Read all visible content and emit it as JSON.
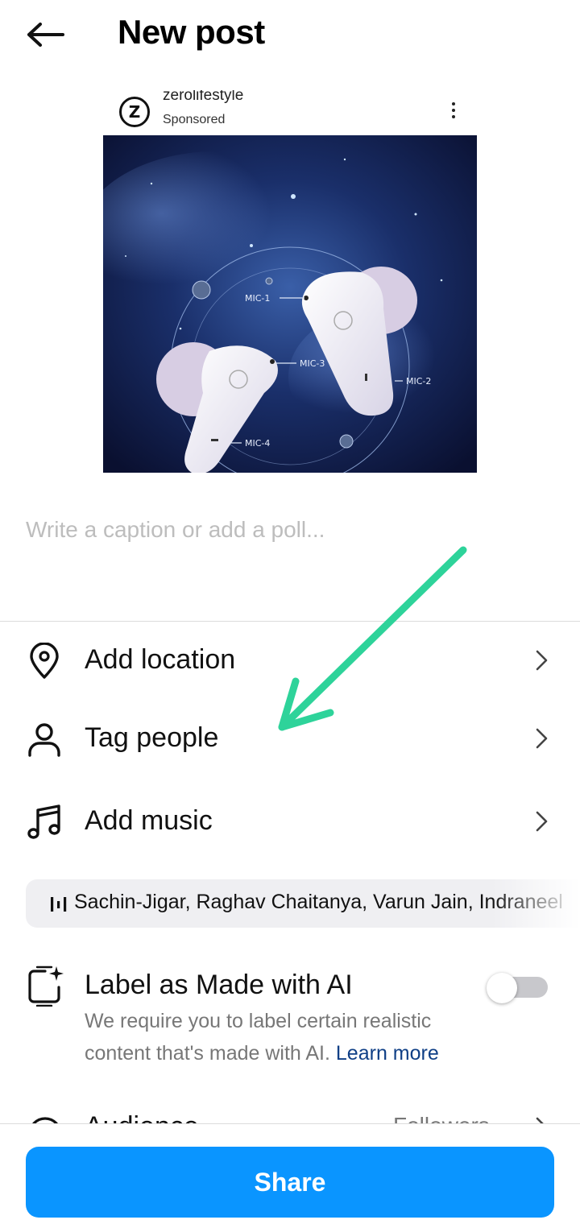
{
  "header": {
    "back_icon": "arrow-left-icon",
    "title": "New post"
  },
  "post": {
    "account_name": "zerolifestyle",
    "sponsored_label": "Sponsored",
    "more_icon": "more-vertical-icon",
    "image_labels": {
      "mic1": "MIC-1",
      "mic2": "MIC-2",
      "mic3": "MIC-3",
      "mic4": "MIC-4"
    }
  },
  "caption": {
    "placeholder": "Write a caption or add a poll...",
    "value": ""
  },
  "options": [
    {
      "label": "Add location",
      "icon": "location-pin-icon"
    },
    {
      "label": "Tag people",
      "icon": "person-icon"
    },
    {
      "label": "Add music",
      "icon": "music-note-icon"
    }
  ],
  "music": {
    "icon": "audio-bars-icon",
    "artists": "Sachin-Jigar, Raghav Chaitanya, Varun Jain, Indraneel"
  },
  "ai_label": {
    "icon": "ai-sparkle-icon",
    "title": "Label as Made with AI",
    "description": "We require you to label certain realistic content that's made with AI.",
    "learn_more": "Learn more",
    "toggle_on": false
  },
  "audience": {
    "label": "Audience",
    "value": "Followers",
    "icon": "globe-icon"
  },
  "footer": {
    "share_label": "Share"
  },
  "colors": {
    "primary": "#0a95ff",
    "link": "#0f3f86",
    "annotation_arrow": "#2ed39a"
  }
}
